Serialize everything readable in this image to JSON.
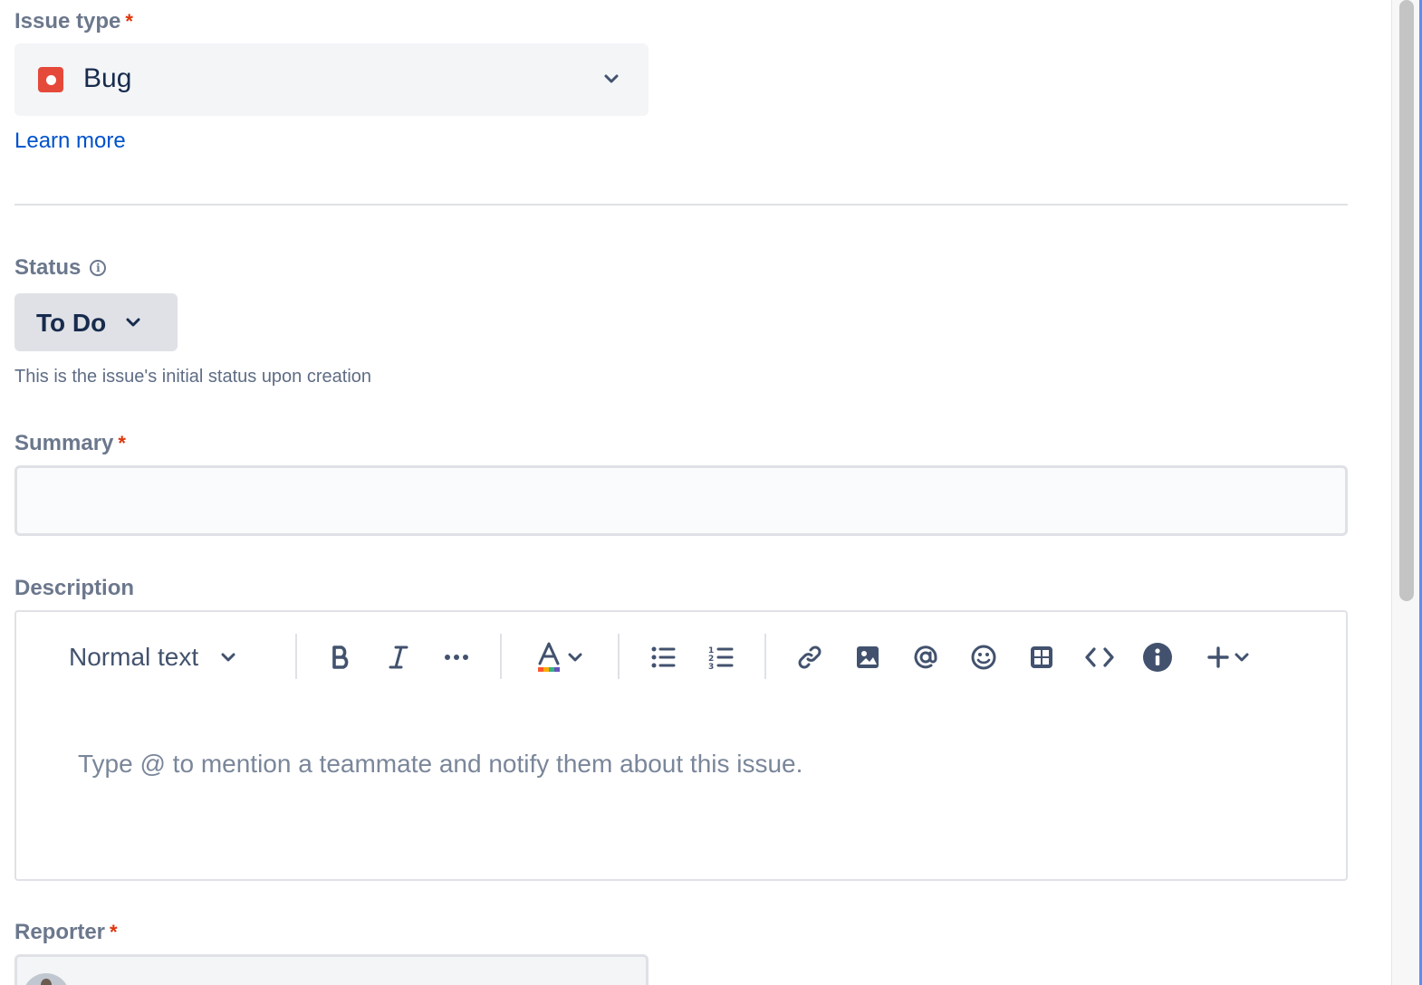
{
  "issue_type": {
    "label": "Issue type",
    "required_marker": "*",
    "value": "Bug",
    "icon": "bug-icon",
    "learn_more": "Learn more"
  },
  "status": {
    "label": "Status",
    "info_icon": "info-icon",
    "value": "To Do",
    "help_text": "This is the issue's initial status upon creation"
  },
  "summary": {
    "label": "Summary",
    "required_marker": "*",
    "value": ""
  },
  "description": {
    "label": "Description",
    "text_style": "Normal text",
    "placeholder": "Type @ to mention a teammate and notify them about this issue.",
    "toolbar": [
      "text-style-dropdown",
      "bold-icon",
      "italic-icon",
      "more-formatting-icon",
      "text-color-icon",
      "bullet-list-icon",
      "numbered-list-icon",
      "link-icon",
      "image-icon",
      "mention-icon",
      "emoji-icon",
      "table-icon",
      "code-icon",
      "info-panel-icon",
      "insert-icon"
    ]
  },
  "reporter": {
    "label": "Reporter",
    "required_marker": "*"
  },
  "colors": {
    "label": "#6b778c",
    "required": "#de350b",
    "link": "#0052cc",
    "bug": "#e5493a",
    "text": "#172b4d"
  }
}
